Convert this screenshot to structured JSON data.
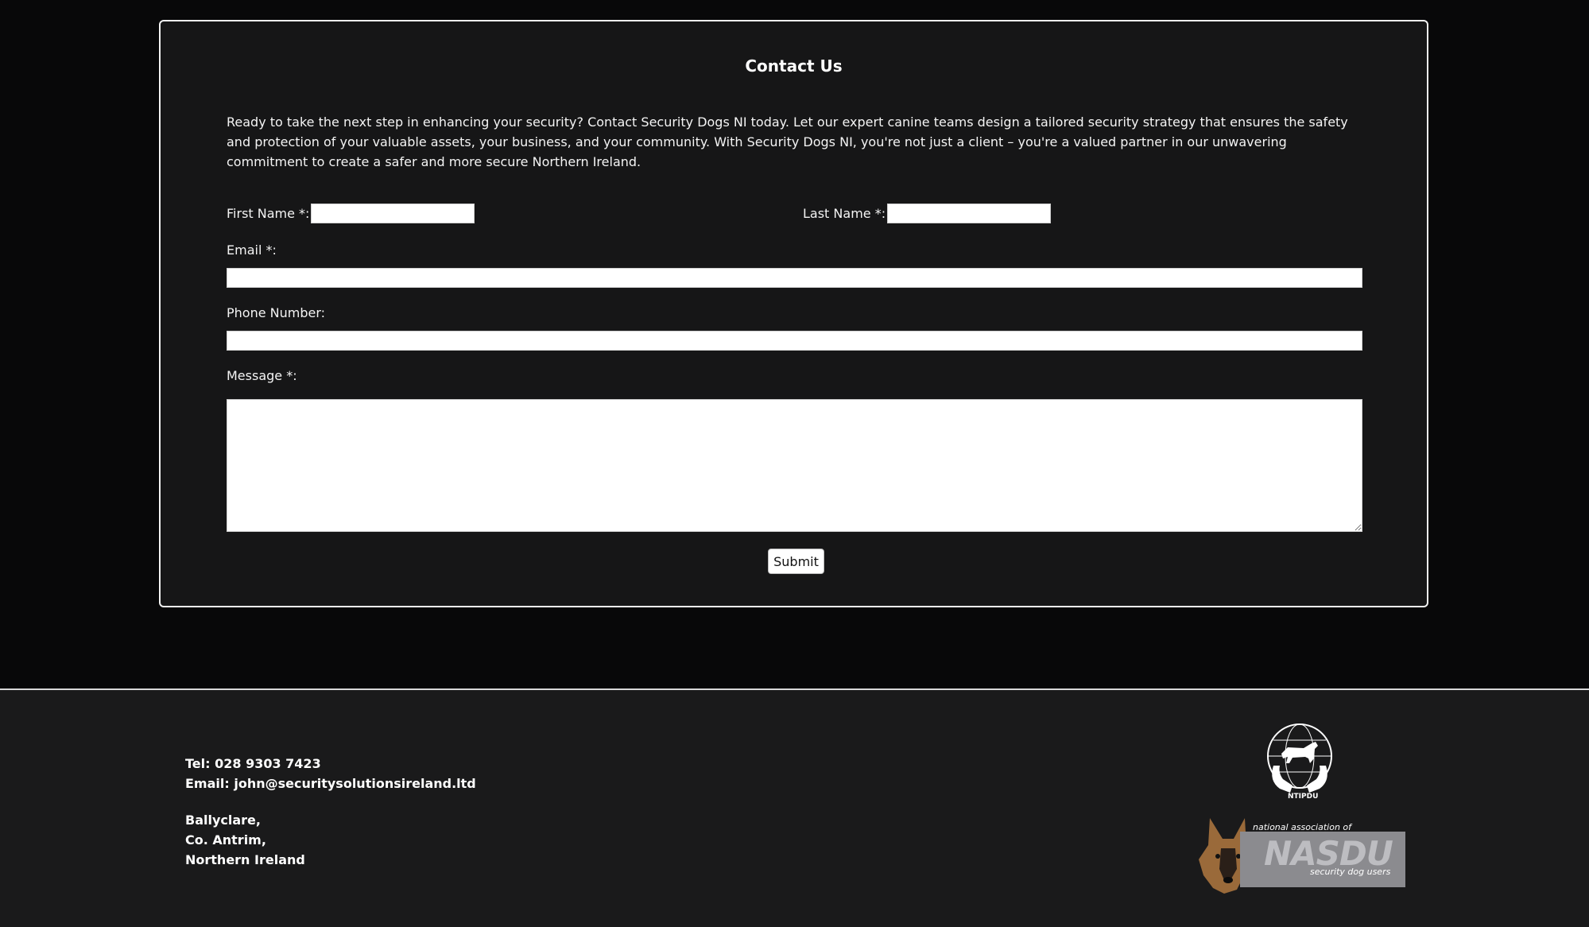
{
  "contact_form": {
    "title": "Contact Us",
    "intro": "Ready to take the next step in enhancing your security? Contact Security Dogs NI today. Let our expert canine teams design a tailored security strategy that ensures the safety and protection of your valuable assets, your business, and your community. With Security Dogs NI, you're not just a client – you're a valued partner in our unwavering commitment to create a safer and more secure Northern Ireland.",
    "first_name_label": "First Name *:",
    "first_name_value": "",
    "last_name_label": "Last Name *:",
    "last_name_value": "",
    "email_label": "Email *:",
    "email_value": "",
    "phone_label": "Phone Number:",
    "phone_value": "",
    "message_label": "Message *:",
    "message_value": "",
    "submit_label": "Submit"
  },
  "footer": {
    "tel": "Tel: 028 9303 7423",
    "email": "Email: john@securitysolutionsireland.ltd",
    "address": [
      "Ballyclare,",
      "Co. Antrim,",
      "Northern Ireland"
    ],
    "logos": {
      "ntipdu_text": "NTIPDU",
      "nasdu_top_text": "national association of",
      "nasdu_wordmark": "NASDU",
      "nasdu_bottom_text": "security dog users"
    }
  },
  "colors": {
    "page_background": "#080809",
    "card_background": "#161617",
    "footer_background": "#1a1a1b",
    "text": "#ffffff",
    "border": "#f2f2f2"
  }
}
